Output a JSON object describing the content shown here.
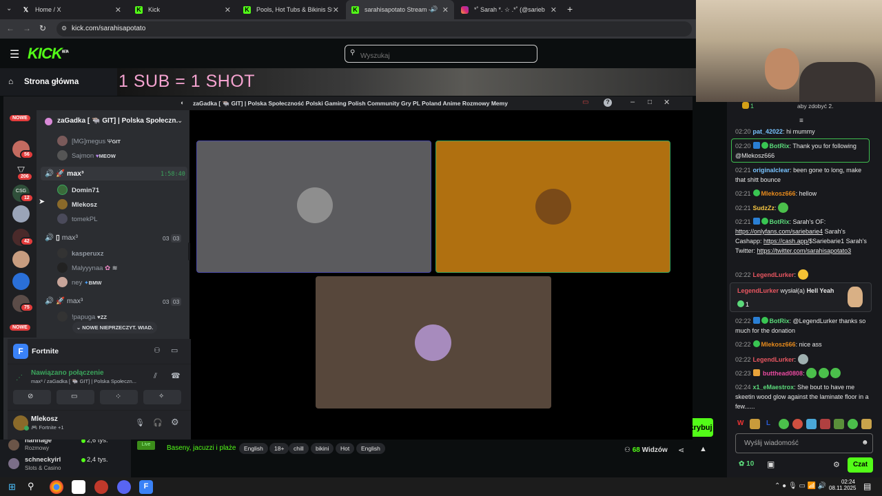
{
  "browser": {
    "tabs": [
      {
        "title": "Home / X",
        "favicon": "x-logo"
      },
      {
        "title": "Kick",
        "favicon": "kick-logo"
      },
      {
        "title": "Pools, Hot Tubs & Bikinis Strea",
        "favicon": "kick-logo"
      },
      {
        "title": "sarahisapotato Stream - W",
        "favicon": "kick-logo"
      },
      {
        "title": "*˚ Sarah *. ☆ .*˚ (@sarieb",
        "favicon": "instagram-logo"
      }
    ],
    "url": "kick.com/sarahisapotato"
  },
  "kick": {
    "logo": "KICK",
    "logo_badge": "BETA",
    "search_placeholder": "Wyszukaj",
    "nav_home": "Strona główna",
    "stream_overlay_text": "1 SUB = 1 SHOT",
    "stream_title": "Baseny, jacuzzi i plaże",
    "tags": [
      "English",
      "18+",
      "chill",
      "bikini",
      "Hot",
      "English"
    ],
    "viewers": "68",
    "viewers_label": "Widzów",
    "subscribe_partial": "ubskrybuj",
    "side_channels": [
      {
        "name": "nahnage",
        "category": "Rozmowy",
        "viewers": "2,6 tys."
      },
      {
        "name": "schneckyirl",
        "category": "Slots & Casino",
        "viewers": "2,4 tys."
      }
    ],
    "live_badge": "Live",
    "chat_top_notice": "aby zdobyć 2.",
    "chat_points": "1",
    "chat": [
      {
        "time": "02:20",
        "user": "pat_42022",
        "text": "hi mummy"
      },
      {
        "time": "02:20",
        "user": "BotRix",
        "text": "Thank you for following @Mlekosz666"
      },
      {
        "time": "02:21",
        "user": "originalclear",
        "text": "been gone to long, make that shitt bounce"
      },
      {
        "time": "02:21",
        "user": "Mlekosz666",
        "text": "hellow"
      },
      {
        "time": "02:21",
        "user": "SudzZz",
        "text": ""
      },
      {
        "time": "02:21",
        "user": "BotRix",
        "text": "Sarah's OF:",
        "link1": "https://onlyfans.com/sariebarie4",
        "mid": "Sarah's Cashapp:",
        "link2": "https://cash.app/",
        "tail": "$Sariebarie1 Sarah's Twitter:",
        "link3": "https://twitter.com/sarahisapotato3"
      },
      {
        "time": "02:22",
        "user": "LegendLurker",
        "text": ""
      },
      {
        "time": "02:22",
        "user": "BotRix",
        "text": "@LegendLurker thanks so much for the donation"
      },
      {
        "time": "02:22",
        "user": "Mlekosz666",
        "text": "nice ass"
      },
      {
        "time": "02:22",
        "user": "LegendLurker",
        "text": ""
      },
      {
        "time": "02:23",
        "user": "butthead0808",
        "text": ""
      },
      {
        "time": "02:24",
        "user": "x1_eMaestrox",
        "text": "She bout to have me skeetin wood glow against the laminate floor in a few......"
      }
    ],
    "gift": {
      "user": "LegendLurker",
      "action": "wysłał(a)",
      "item": "Hell Yeah",
      "count": "1"
    },
    "chat_input_placeholder": "Wyślij wiadomość",
    "chat_points_bottom": "10",
    "chat_button": "Czat"
  },
  "discord": {
    "window_title": "zaGadka [ 🐃 GIT] | Polska Społeczność Polski Gaming Polish Community Gry PL Poland Anime Rozmowy Memy",
    "server_name": "zaGadka [ 🐃 GIT] | Polska Społeczn...",
    "new_label": "NOWE",
    "server_badges": [
      "56",
      "206",
      "12",
      "42",
      "75"
    ],
    "channels": [
      {
        "type": "user",
        "name": "[MG]megus",
        "tag": "GIT"
      },
      {
        "type": "user",
        "name": "Sajmon",
        "tag": "MEOW"
      },
      {
        "type": "voice",
        "name": "max³",
        "extra": "1:58:40"
      },
      {
        "type": "user",
        "name": "Domin71"
      },
      {
        "type": "user",
        "name": "Mlekosz"
      },
      {
        "type": "user",
        "name": "tomekPL"
      },
      {
        "type": "voice",
        "name": "max³",
        "count_a": "03",
        "count_b": "03"
      },
      {
        "type": "user",
        "name": "kasperuxz"
      },
      {
        "type": "user",
        "name": "Malyyynaa"
      },
      {
        "type": "user",
        "name": "ney",
        "tag": "BMW"
      },
      {
        "type": "voice",
        "name": "max³",
        "count_a": "03",
        "count_b": "03"
      },
      {
        "type": "user",
        "name": "!papuga",
        "tag": "ZZ"
      }
    ],
    "new_messages": "NOWE NIEPRZECZYT. WIAD.",
    "game": "Fortnite",
    "connection_status": "Nawiązano połączenie",
    "connection_channel": "max³ / zaGadka [ 🐃 GIT] | Polska Społeczn...",
    "user_name": "Mlekosz",
    "user_status": "Fortnite +1"
  },
  "taskbar": {
    "time": "02:24",
    "date": "08.11.2025"
  },
  "colors": {
    "kick_green": "#53fc18",
    "discord_bg": "#2b2d31",
    "tile_gray": "#5b5b5e",
    "tile_orange": "#b07010",
    "tile_brown": "#57473b"
  }
}
